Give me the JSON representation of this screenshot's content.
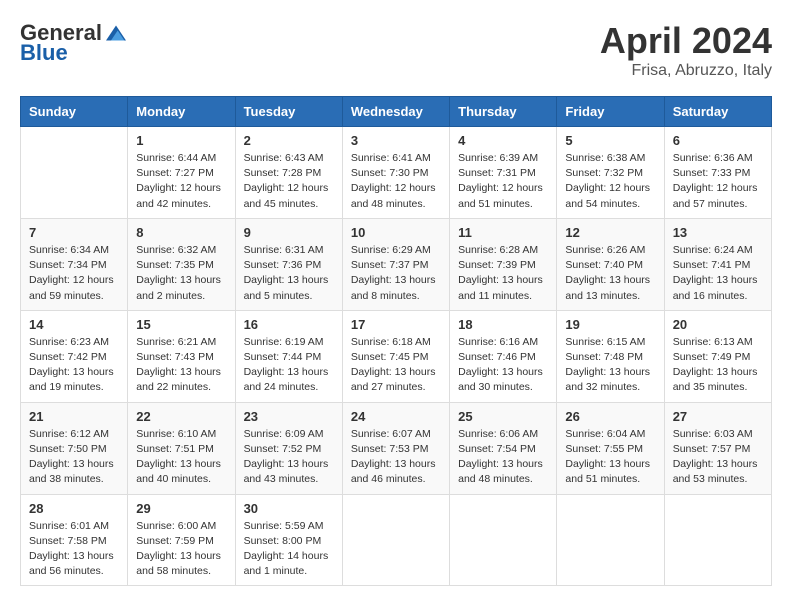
{
  "logo": {
    "general": "General",
    "blue": "Blue"
  },
  "title": "April 2024",
  "location": "Frisa, Abruzzo, Italy",
  "days_of_week": [
    "Sunday",
    "Monday",
    "Tuesday",
    "Wednesday",
    "Thursday",
    "Friday",
    "Saturday"
  ],
  "weeks": [
    [
      null,
      {
        "day": 1,
        "sunrise": "6:44 AM",
        "sunset": "7:27 PM",
        "daylight": "12 hours and 42 minutes."
      },
      {
        "day": 2,
        "sunrise": "6:43 AM",
        "sunset": "7:28 PM",
        "daylight": "12 hours and 45 minutes."
      },
      {
        "day": 3,
        "sunrise": "6:41 AM",
        "sunset": "7:30 PM",
        "daylight": "12 hours and 48 minutes."
      },
      {
        "day": 4,
        "sunrise": "6:39 AM",
        "sunset": "7:31 PM",
        "daylight": "12 hours and 51 minutes."
      },
      {
        "day": 5,
        "sunrise": "6:38 AM",
        "sunset": "7:32 PM",
        "daylight": "12 hours and 54 minutes."
      },
      {
        "day": 6,
        "sunrise": "6:36 AM",
        "sunset": "7:33 PM",
        "daylight": "12 hours and 57 minutes."
      }
    ],
    [
      {
        "day": 7,
        "sunrise": "6:34 AM",
        "sunset": "7:34 PM",
        "daylight": "12 hours and 59 minutes."
      },
      {
        "day": 8,
        "sunrise": "6:32 AM",
        "sunset": "7:35 PM",
        "daylight": "13 hours and 2 minutes."
      },
      {
        "day": 9,
        "sunrise": "6:31 AM",
        "sunset": "7:36 PM",
        "daylight": "13 hours and 5 minutes."
      },
      {
        "day": 10,
        "sunrise": "6:29 AM",
        "sunset": "7:37 PM",
        "daylight": "13 hours and 8 minutes."
      },
      {
        "day": 11,
        "sunrise": "6:28 AM",
        "sunset": "7:39 PM",
        "daylight": "13 hours and 11 minutes."
      },
      {
        "day": 12,
        "sunrise": "6:26 AM",
        "sunset": "7:40 PM",
        "daylight": "13 hours and 13 minutes."
      },
      {
        "day": 13,
        "sunrise": "6:24 AM",
        "sunset": "7:41 PM",
        "daylight": "13 hours and 16 minutes."
      }
    ],
    [
      {
        "day": 14,
        "sunrise": "6:23 AM",
        "sunset": "7:42 PM",
        "daylight": "13 hours and 19 minutes."
      },
      {
        "day": 15,
        "sunrise": "6:21 AM",
        "sunset": "7:43 PM",
        "daylight": "13 hours and 22 minutes."
      },
      {
        "day": 16,
        "sunrise": "6:19 AM",
        "sunset": "7:44 PM",
        "daylight": "13 hours and 24 minutes."
      },
      {
        "day": 17,
        "sunrise": "6:18 AM",
        "sunset": "7:45 PM",
        "daylight": "13 hours and 27 minutes."
      },
      {
        "day": 18,
        "sunrise": "6:16 AM",
        "sunset": "7:46 PM",
        "daylight": "13 hours and 30 minutes."
      },
      {
        "day": 19,
        "sunrise": "6:15 AM",
        "sunset": "7:48 PM",
        "daylight": "13 hours and 32 minutes."
      },
      {
        "day": 20,
        "sunrise": "6:13 AM",
        "sunset": "7:49 PM",
        "daylight": "13 hours and 35 minutes."
      }
    ],
    [
      {
        "day": 21,
        "sunrise": "6:12 AM",
        "sunset": "7:50 PM",
        "daylight": "13 hours and 38 minutes."
      },
      {
        "day": 22,
        "sunrise": "6:10 AM",
        "sunset": "7:51 PM",
        "daylight": "13 hours and 40 minutes."
      },
      {
        "day": 23,
        "sunrise": "6:09 AM",
        "sunset": "7:52 PM",
        "daylight": "13 hours and 43 minutes."
      },
      {
        "day": 24,
        "sunrise": "6:07 AM",
        "sunset": "7:53 PM",
        "daylight": "13 hours and 46 minutes."
      },
      {
        "day": 25,
        "sunrise": "6:06 AM",
        "sunset": "7:54 PM",
        "daylight": "13 hours and 48 minutes."
      },
      {
        "day": 26,
        "sunrise": "6:04 AM",
        "sunset": "7:55 PM",
        "daylight": "13 hours and 51 minutes."
      },
      {
        "day": 27,
        "sunrise": "6:03 AM",
        "sunset": "7:57 PM",
        "daylight": "13 hours and 53 minutes."
      }
    ],
    [
      {
        "day": 28,
        "sunrise": "6:01 AM",
        "sunset": "7:58 PM",
        "daylight": "13 hours and 56 minutes."
      },
      {
        "day": 29,
        "sunrise": "6:00 AM",
        "sunset": "7:59 PM",
        "daylight": "13 hours and 58 minutes."
      },
      {
        "day": 30,
        "sunrise": "5:59 AM",
        "sunset": "8:00 PM",
        "daylight": "14 hours and 1 minute."
      },
      null,
      null,
      null,
      null
    ]
  ]
}
